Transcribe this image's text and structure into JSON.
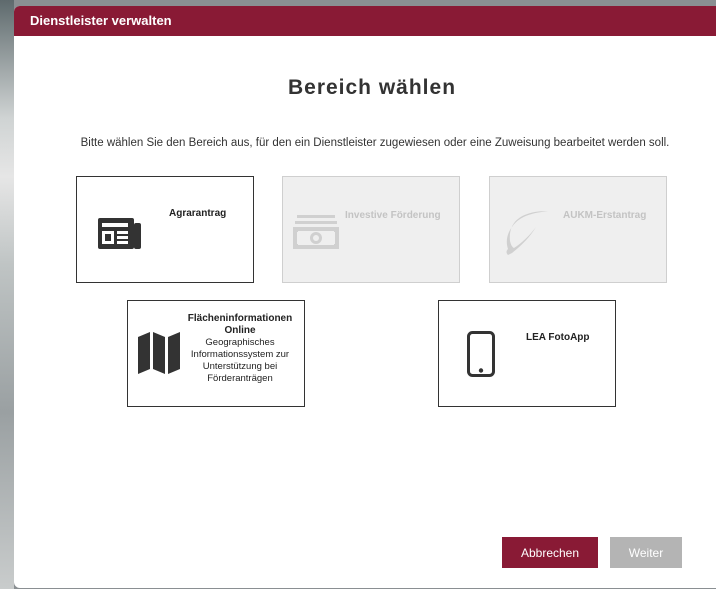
{
  "dialog": {
    "title": "Dienstleister verwalten",
    "heading": "Bereich wählen",
    "intro": "Bitte wählen Sie den Bereich aus, für den ein Dienstleister zugewiesen oder eine Zuweisung bearbeitet werden soll."
  },
  "tiles": [
    {
      "label": "Agrarantrag",
      "icon": "newspaper-icon",
      "enabled": true
    },
    {
      "label": "Investive Förderung",
      "icon": "money-icon",
      "enabled": false
    },
    {
      "label": "AUKM-Erstantrag",
      "icon": "leaf-icon",
      "enabled": false
    },
    {
      "label": "Flächeninformationen Online",
      "description": "Geographisches Informationssystem zur Unterstützung bei Förderanträgen",
      "icon": "map-icon",
      "enabled": true
    },
    {
      "label": "LEA FotoApp",
      "icon": "smartphone-icon",
      "enabled": true
    }
  ],
  "buttons": {
    "cancel": "Abbrechen",
    "next": "Weiter"
  },
  "colors": {
    "accent": "#891a35",
    "disabled": "#b4b4b4"
  }
}
